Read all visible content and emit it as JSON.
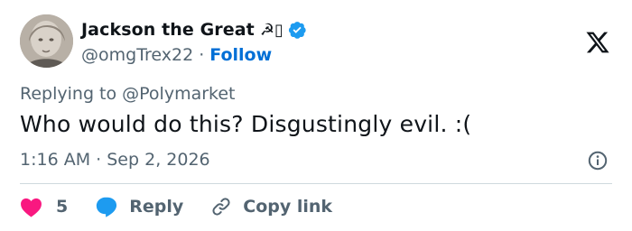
{
  "author": {
    "display_name": "Jackson the Great",
    "name_emoji": "☭▯",
    "handle": "@omgTrex22",
    "separator": "·",
    "follow_label": "Follow"
  },
  "tweet": {
    "replying_to": "Replying to @Polymarket",
    "text": "Who would do this? Disgustingly evil. :(",
    "time": "1:16 AM",
    "date_separator": "·",
    "date": "Sep 2, 2026"
  },
  "actions": {
    "like_count": "5",
    "reply_label": "Reply",
    "copy_label": "Copy link"
  },
  "colors": {
    "accent": "#1d9bf0",
    "follow": "#006fd6",
    "like": "#f91880",
    "muted": "#536471"
  },
  "icons": {
    "verified": "verified-badge-icon",
    "logo": "x-logo-icon",
    "info": "info-icon",
    "like": "heart-icon",
    "reply": "speech-bubble-icon",
    "copy": "link-icon"
  }
}
